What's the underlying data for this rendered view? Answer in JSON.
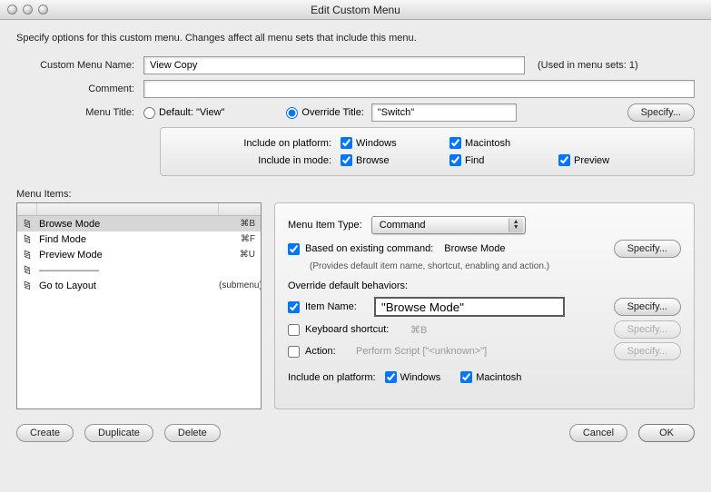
{
  "window": {
    "title": "Edit Custom Menu"
  },
  "intro": "Specify options for this custom menu.  Changes affect all menu sets that include this menu.",
  "labels": {
    "customMenuName": "Custom Menu Name:",
    "usedIn": "(Used in menu sets: 1)",
    "comment": "Comment:",
    "menuTitle": "Menu Title:",
    "defaultRadio": "Default: \"View\"",
    "overrideRadio": "Override Title:",
    "specify": "Specify...",
    "includePlatform": "Include on platform:",
    "includeMode": "Include in mode:",
    "menuItems": "Menu Items:",
    "menuItemType": "Menu Item Type:",
    "basedOn": "Based on existing command:",
    "hint": "(Provides default item name, shortcut, enabling and action.)",
    "overrideBehaviors": "Override default behaviors:",
    "itemName": "Item Name:",
    "kbShortcut": "Keyboard shortcut:",
    "action": "Action:",
    "includePlatform2": "Include on platform:"
  },
  "fields": {
    "menuName": "View Copy",
    "comment": "",
    "overrideTitle": "\"Switch\"",
    "itemName": "\"Browse Mode\""
  },
  "radios": {
    "menuTitle": "override"
  },
  "platform": {
    "windows": "Windows",
    "macintosh": "Macintosh",
    "browse": "Browse",
    "find": "Find",
    "preview": "Preview"
  },
  "checks": {
    "platWindows": true,
    "platMac": true,
    "modeBrowse": true,
    "modeFind": true,
    "modePreview": true,
    "basedOn": true,
    "itemName": true,
    "kbShortcut": false,
    "action": false,
    "itemPlatWindows": true,
    "itemPlatMac": true
  },
  "menuItemTypeValue": "Command",
  "basedOnCommand": "Browse Mode",
  "kbShortcutValue": "⌘B",
  "actionValue": "Perform Script [\"<unknown>\"]",
  "list": [
    {
      "name": "Browse Mode",
      "shortcut": "⌘B",
      "selected": true
    },
    {
      "name": "Find Mode",
      "shortcut": "⌘F"
    },
    {
      "name": "Preview Mode",
      "shortcut": "⌘U"
    },
    {
      "name": "——————",
      "shortcut": "",
      "divider": true
    },
    {
      "name": "Go to Layout",
      "shortcut": "(submenu)"
    }
  ],
  "buttons": {
    "create": "Create",
    "duplicate": "Duplicate",
    "delete": "Delete",
    "cancel": "Cancel",
    "ok": "OK"
  }
}
